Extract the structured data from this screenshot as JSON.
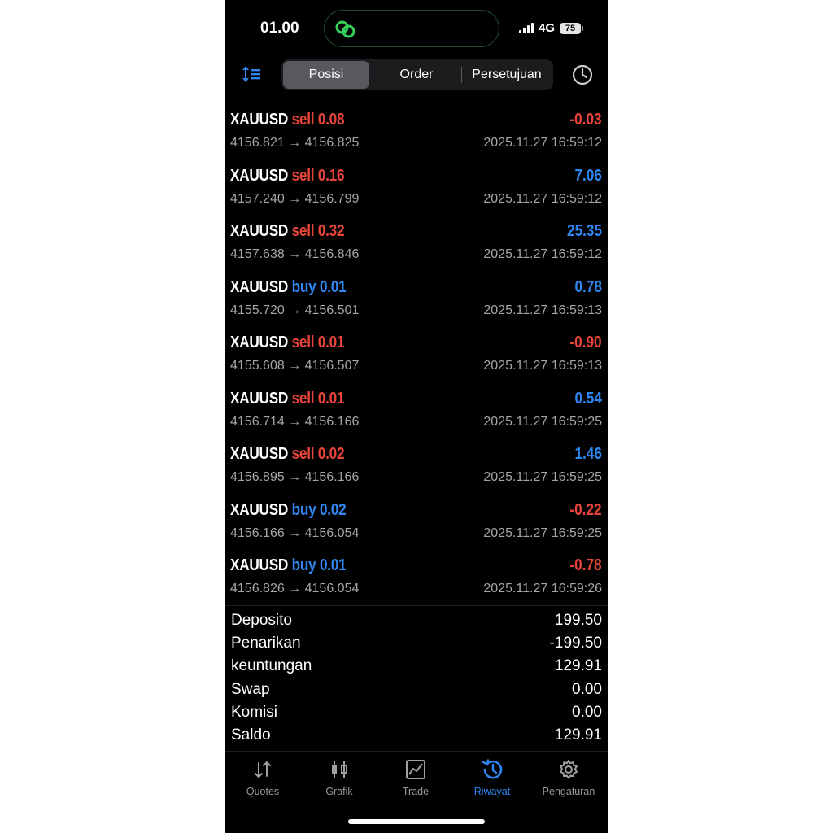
{
  "status": {
    "time": "01.00",
    "network": "4G",
    "battery": "75"
  },
  "colors": {
    "sell": "#e8443a",
    "buy": "#2f86f0",
    "negative": "#e8443a",
    "positive": "#2f86f0",
    "accent": "#2f86f0",
    "island_icon": "#35d05a"
  },
  "header": {
    "sort_icon": "sort-icon",
    "tabs": [
      {
        "label": "Posisi",
        "active": true
      },
      {
        "label": "Order",
        "active": false
      },
      {
        "label": "Persetujuan",
        "active": false
      }
    ],
    "history_icon": "clock-icon"
  },
  "deals": [
    {
      "symbol": "XAUUSD",
      "type": "sell",
      "volume": "0.08",
      "profit": "-0.03",
      "prices": "4156.821 → 4156.825",
      "time": "2025.11.27 16:59:12"
    },
    {
      "symbol": "XAUUSD",
      "type": "sell",
      "volume": "0.16",
      "profit": "7.06",
      "prices": "4157.240 → 4156.799",
      "time": "2025.11.27 16:59:12"
    },
    {
      "symbol": "XAUUSD",
      "type": "sell",
      "volume": "0.32",
      "profit": "25.35",
      "prices": "4157.638 → 4156.846",
      "time": "2025.11.27 16:59:12"
    },
    {
      "symbol": "XAUUSD",
      "type": "buy",
      "volume": "0.01",
      "profit": "0.78",
      "prices": "4155.720 → 4156.501",
      "time": "2025.11.27 16:59:13"
    },
    {
      "symbol": "XAUUSD",
      "type": "sell",
      "volume": "0.01",
      "profit": "-0.90",
      "prices": "4155.608 → 4156.507",
      "time": "2025.11.27 16:59:13"
    },
    {
      "symbol": "XAUUSD",
      "type": "sell",
      "volume": "0.01",
      "profit": "0.54",
      "prices": "4156.714 → 4156.166",
      "time": "2025.11.27 16:59:25"
    },
    {
      "symbol": "XAUUSD",
      "type": "sell",
      "volume": "0.02",
      "profit": "1.46",
      "prices": "4156.895 → 4156.166",
      "time": "2025.11.27 16:59:25"
    },
    {
      "symbol": "XAUUSD",
      "type": "buy",
      "volume": "0.02",
      "profit": "-0.22",
      "prices": "4156.166 → 4156.054",
      "time": "2025.11.27 16:59:25"
    },
    {
      "symbol": "XAUUSD",
      "type": "buy",
      "volume": "0.01",
      "profit": "-0.78",
      "prices": "4156.826 → 4156.054",
      "time": "2025.11.27 16:59:26"
    }
  ],
  "summary": [
    {
      "label": "Deposito",
      "value": "199.50"
    },
    {
      "label": "Penarikan",
      "value": "-199.50"
    },
    {
      "label": "keuntungan",
      "value": "129.91"
    },
    {
      "label": "Swap",
      "value": "0.00"
    },
    {
      "label": "Komisi",
      "value": "0.00"
    },
    {
      "label": "Saldo",
      "value": "129.91"
    }
  ],
  "tabbar": [
    {
      "label": "Quotes",
      "icon": "quotes-icon",
      "active": false
    },
    {
      "label": "Grafik",
      "icon": "chart-candles-icon",
      "active": false
    },
    {
      "label": "Trade",
      "icon": "trade-icon",
      "active": false
    },
    {
      "label": "Riwayat",
      "icon": "history-icon",
      "active": true
    },
    {
      "label": "Pengaturan",
      "icon": "gear-icon",
      "active": false
    }
  ]
}
